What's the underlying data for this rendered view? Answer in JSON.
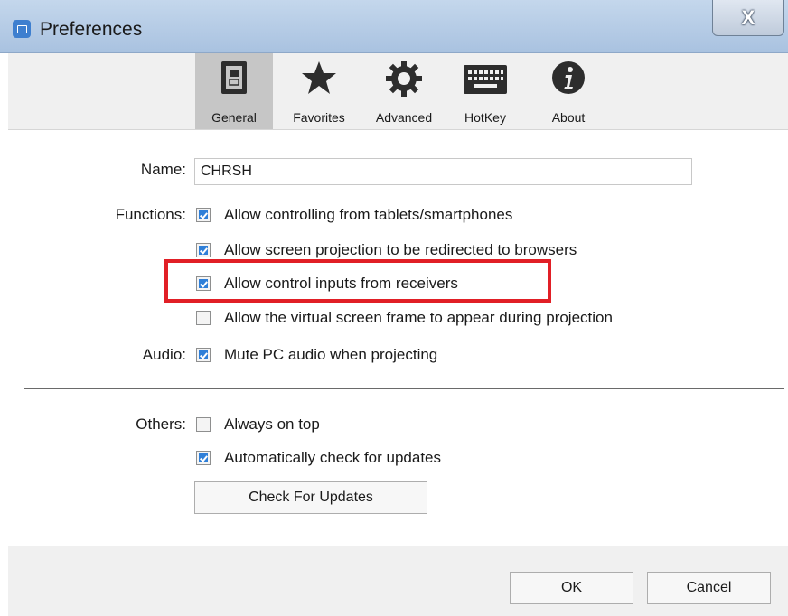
{
  "window": {
    "title": "Preferences",
    "close_glyph": "X"
  },
  "toolbar": {
    "items": [
      {
        "label": "General",
        "icon": "general-switch-icon",
        "active": true
      },
      {
        "label": "Favorites",
        "icon": "star-icon",
        "active": false
      },
      {
        "label": "Advanced",
        "icon": "gear-icon",
        "active": false
      },
      {
        "label": "HotKey",
        "icon": "keyboard-icon",
        "active": false
      },
      {
        "label": "About",
        "icon": "info-icon",
        "active": false
      }
    ]
  },
  "general": {
    "name_label": "Name:",
    "name_value": "CHRSH",
    "functions_label": "Functions:",
    "functions": [
      {
        "label": "Allow controlling from tablets/smartphones",
        "checked": true
      },
      {
        "label": "Allow screen projection to be redirected to browsers",
        "checked": true
      },
      {
        "label": "Allow control inputs from receivers",
        "checked": true,
        "highlighted": true
      },
      {
        "label": "Allow the virtual screen frame to appear during projection",
        "checked": false
      }
    ],
    "audio_label": "Audio:",
    "audio": {
      "label": "Mute PC audio when projecting",
      "checked": true
    },
    "others_label": "Others:",
    "others": [
      {
        "label": "Always on top",
        "checked": false
      },
      {
        "label": "Automatically check for updates",
        "checked": true
      }
    ],
    "check_updates_button": "Check For Updates"
  },
  "footer": {
    "ok_label": "OK",
    "cancel_label": "Cancel"
  },
  "colors": {
    "highlight": "#e11f26",
    "checkbox_checked": "#2f7fd8",
    "title_bar": "#b8cde6"
  }
}
